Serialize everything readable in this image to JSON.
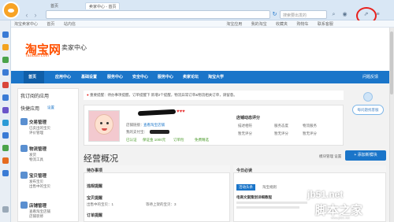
{
  "browser": {
    "tabs": [
      {
        "label": "首页"
      },
      {
        "label": "卖家中心 - 首页"
      }
    ],
    "search_placeholder": "搜索要出发的",
    "favorites": [
      "淘宝卖家中心",
      "首页",
      "站内信",
      "淘宝应用",
      "我的淘宝",
      "收藏夹",
      "购物车",
      "联系客服"
    ]
  },
  "header": {
    "logo": "淘宝网",
    "logo_sub": "Taobao.com",
    "seller_center": "卖家中心"
  },
  "nav": {
    "items": [
      "首页",
      "应用中心",
      "基础设置",
      "服务中心",
      "安全中心",
      "服务中心",
      "卖家论坛",
      "淘宝大学"
    ],
    "right": "问题反馈"
  },
  "left": {
    "my_apps": "我订阅的应用",
    "quick_nav": "快捷应用",
    "quick_set": "设置",
    "categories": [
      {
        "title": "交易管理",
        "links": [
          "已卖出的宝贝",
          "评价管理"
        ]
      },
      {
        "title": "物流管理",
        "links": [
          "发货",
          "物流工具"
        ]
      },
      {
        "title": "宝贝管理",
        "links": [
          "发布宝贝",
          "出售中的宝贝"
        ]
      },
      {
        "title": "店铺管理",
        "links": [
          "查看淘宝店铺",
          "店铺装修"
        ]
      }
    ]
  },
  "notice": "重要提醒：待办事项提醒，订单提醒下 新增2个提醒，物流异常订单&物流相关订单，请留意。",
  "profile": {
    "shop_link_label": "店铺链接：",
    "shop_link": "查看淘宝店铺",
    "account_label": "我的支付宝：",
    "rating_title": "店铺动态评分",
    "ratings": [
      {
        "name": "描述相符",
        "value": "暂无评分"
      },
      {
        "name": "服务态度",
        "value": "暂无评分"
      },
      {
        "name": "物流服务",
        "value": "暂无评分"
      }
    ],
    "badges": [
      "已认证",
      "保证金 1000元",
      "订单险",
      "免费精选"
    ]
  },
  "overview": {
    "title": "经营概况",
    "todo_title": "待办事项",
    "sections": [
      {
        "title": "违规提醒",
        "rows": []
      },
      {
        "title": "宝贝提醒",
        "rows": [
          "出售中的宝贝：1",
          "等待上架的宝贝：3"
        ]
      },
      {
        "title": "订单提醒",
        "rows": []
      }
    ],
    "add_module": "+ 添加新模块",
    "manage": "模块管理 设置",
    "today_title": "今日必读",
    "today_tabs": [
      "活动头条",
      "淘宝规则"
    ],
    "today_item": "电商文案策划详细教程"
  },
  "sidebar_bubble": "每问题找客服",
  "watermark": {
    "site": "jb51.net",
    "name": "脚本之家",
    "url": "www.jb51.net"
  }
}
